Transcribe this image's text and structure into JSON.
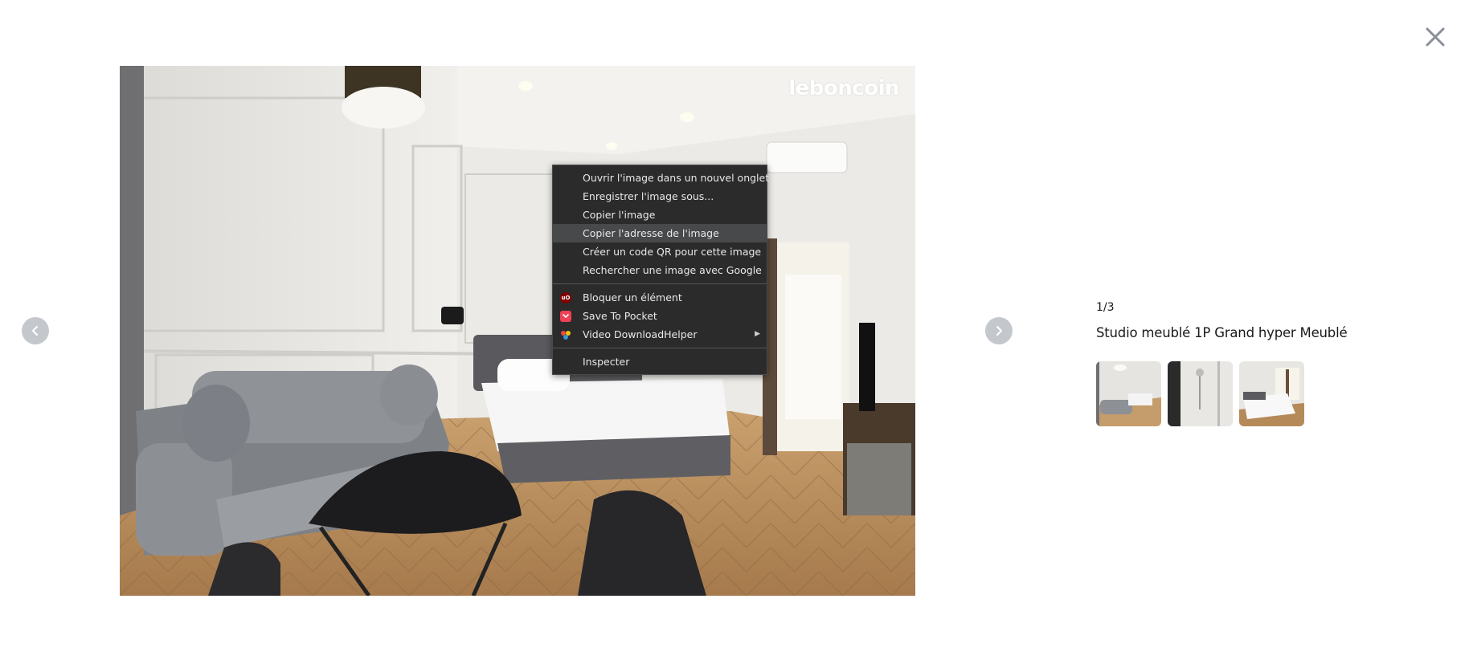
{
  "viewer": {
    "counter": "1/3",
    "listing_title": "Studio meublé 1P Grand hyper Meublé",
    "watermark": "leboncoin",
    "thumbnails": [
      {
        "name": "thumb-living-room"
      },
      {
        "name": "thumb-shower"
      },
      {
        "name": "thumb-bedroom"
      }
    ]
  },
  "context_menu": {
    "items": [
      "Ouvrir l'image dans un nouvel onglet",
      "Enregistrer l'image sous...",
      "Copier l'image",
      "Copier l'adresse de l'image",
      "Créer un code QR pour cette image",
      "Rechercher une image avec Google"
    ],
    "extensions": [
      {
        "label": "Bloquer un élément",
        "icon": "ublock-icon",
        "color": "#800000"
      },
      {
        "label": "Save To Pocket",
        "icon": "pocket-icon",
        "color": "#ef4056"
      },
      {
        "label": "Video DownloadHelper",
        "icon": "downloadhelper-icon",
        "has_submenu": true
      }
    ],
    "inspect": "Inspecter",
    "highlighted_item": "Copier l'adresse de l'image"
  },
  "colors": {
    "nav_arrow_bg": "#c4c7cc",
    "close_icon": "#8a9099",
    "menu_bg": "#2b2b2c",
    "menu_hover": "#48494b"
  }
}
